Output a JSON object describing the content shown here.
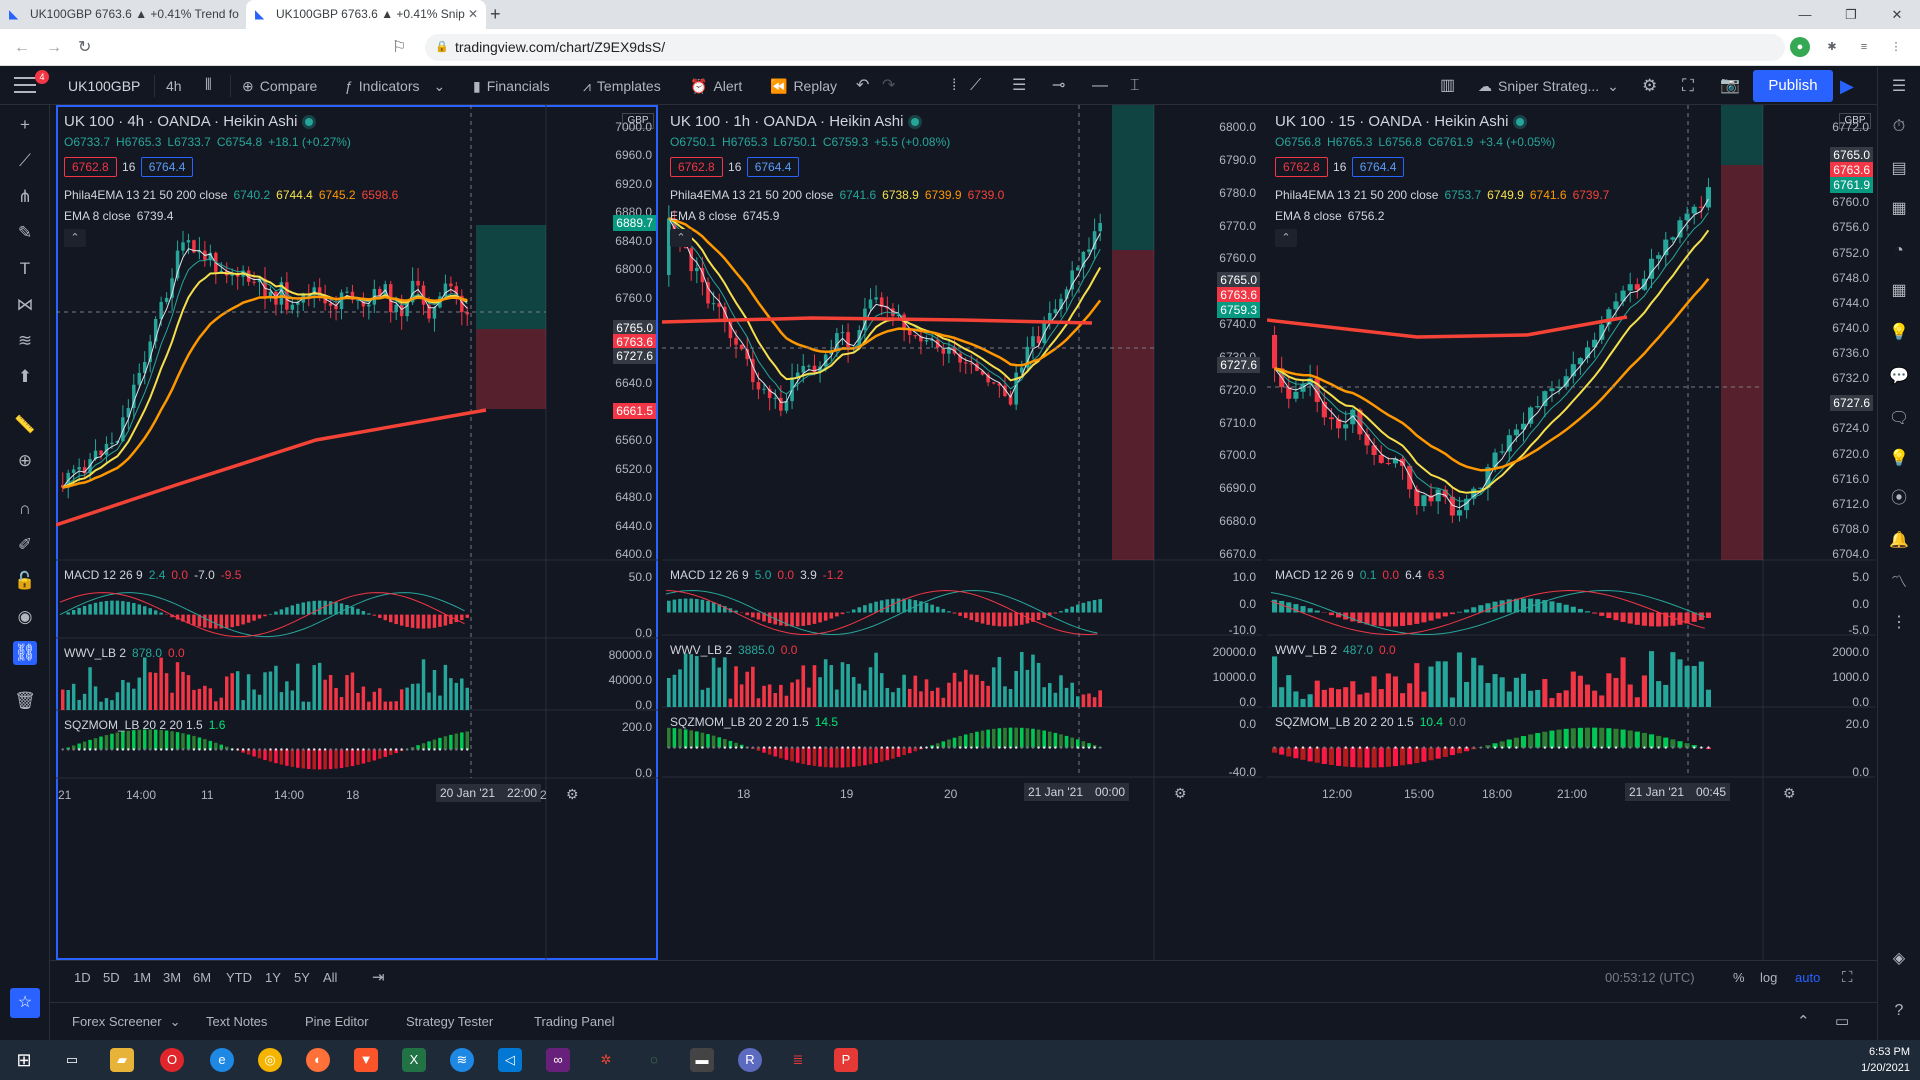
{
  "browser": {
    "tabs": [
      {
        "title": "UK100GBP 6763.6 ▲ +0.41% Trend fo"
      },
      {
        "title": "UK100GBP 6763.6 ▲ +0.41% Snip"
      }
    ],
    "url": "tradingview.com/chart/Z9EX9dsS/"
  },
  "toolbar": {
    "menu_badge": "4",
    "symbol": "UK100GBP",
    "interval": "4h",
    "compare": "Compare",
    "indicators": "Indicators",
    "financials": "Financials",
    "templates": "Templates",
    "alert": "Alert",
    "replay": "Replay",
    "layout_name": "Sniper Strateg...",
    "publish": "Publish"
  },
  "panes": [
    {
      "title": "UK 100 · 4h · OANDA · Heikin Ashi",
      "ohlc": {
        "o": "O6733.7",
        "h": "H6765.3",
        "l": "L6733.7",
        "c": "C6754.8",
        "chg": "+18.1 (+0.27%)"
      },
      "sell": "6762.8",
      "qty": "16",
      "buy": "6764.4",
      "ema_label": "Phila4EMA 13 21 50 200 close",
      "ema_vals": [
        "6740.2",
        "6744.4",
        "6745.2",
        "6598.6"
      ],
      "ema8_label": "EMA 8 close",
      "ema8_val": "6739.4",
      "macd_label": "MACD 12 26 9",
      "macd_vals": [
        "2.4",
        "0.0",
        "-7.0",
        "-9.5"
      ],
      "wwv_label": "WWV_LB 2",
      "wwv_vals": [
        "878.0",
        "0.0"
      ],
      "sqz_label": "SQZMOM_LB 20 2 20 1.5",
      "sqz_vals": [
        "1.6"
      ],
      "currency": "GBP",
      "price_labels": [
        "7000.0",
        "6960.0",
        "6920.0",
        "6880.0",
        "6840.0",
        "6800.0",
        "6760.0",
        "6720.0",
        "6680.0",
        "6640.0",
        "6600.0",
        "6560.0",
        "6520.0",
        "6480.0",
        "6440.0",
        "6400.0"
      ],
      "price_tags": [
        {
          "val": "6889.7",
          "color": "#089981"
        },
        {
          "val": "6765.0",
          "color": "#363a45"
        },
        {
          "val": "6763.6",
          "color": "#f23645"
        },
        {
          "val": "6727.6",
          "color": "#363a45"
        },
        {
          "val": "6661.5",
          "color": "#f23645"
        }
      ],
      "macd_axis": [
        "50.0",
        "0.0"
      ],
      "wwv_axis": [
        "80000.0",
        "40000.0",
        "0.0"
      ],
      "sqz_axis": [
        "200.0",
        "0.0"
      ],
      "time_labels": [
        "21",
        "14:00",
        "11",
        "14:00",
        "18"
      ],
      "time_sel": [
        "20 Jan '21",
        "22:00"
      ],
      "time_extra": "2"
    },
    {
      "title": "UK 100 · 1h · OANDA · Heikin Ashi",
      "ohlc": {
        "o": "O6750.1",
        "h": "H6765.3",
        "l": "L6750.1",
        "c": "C6759.3",
        "chg": "+5.5 (+0.08%)"
      },
      "sell": "6762.8",
      "qty": "16",
      "buy": "6764.4",
      "ema_label": "Phila4EMA 13 21 50 200 close",
      "ema_vals": [
        "6741.6",
        "6738.9",
        "6739.9",
        "6739.0"
      ],
      "ema8_label": "EMA 8 close",
      "ema8_val": "6745.9",
      "macd_label": "MACD 12 26 9",
      "macd_vals": [
        "5.0",
        "0.0",
        "3.9",
        "-1.2"
      ],
      "wwv_label": "WWV_LB 2",
      "wwv_vals": [
        "3885.0",
        "0.0"
      ],
      "sqz_label": "SQZMOM_LB 20 2 20 1.5",
      "sqz_vals": [
        "14.5"
      ],
      "price_labels": [
        "6800.0",
        "6790.0",
        "6780.0",
        "6770.0",
        "6760.0",
        "6750.0",
        "6740.0",
        "6730.0",
        "6720.0",
        "6710.0",
        "6700.0",
        "6690.0",
        "6680.0",
        "6670.0"
      ],
      "price_tags": [
        {
          "val": "6765.0",
          "color": "#363a45"
        },
        {
          "val": "6763.6",
          "color": "#f23645"
        },
        {
          "val": "6759.3",
          "color": "#089981"
        },
        {
          "val": "6727.6",
          "color": "#363a45"
        }
      ],
      "macd_axis": [
        "10.0",
        "0.0",
        "-10.0"
      ],
      "wwv_axis": [
        "20000.0",
        "10000.0",
        "0.0"
      ],
      "sqz_axis": [
        "0.0",
        "-40.0"
      ],
      "time_labels": [
        "18",
        "19",
        "20"
      ],
      "time_sel": [
        "21 Jan '21",
        "00:00"
      ]
    },
    {
      "title": "UK 100 · 15 · OANDA · Heikin Ashi",
      "ohlc": {
        "o": "O6756.8",
        "h": "H6765.3",
        "l": "L6756.8",
        "c": "C6761.9",
        "chg": "+3.4 (+0.05%)"
      },
      "sell": "6762.8",
      "qty": "16",
      "buy": "6764.4",
      "ema_label": "Phila4EMA 13 21 50 200 close",
      "ema_vals": [
        "6753.7",
        "6749.9",
        "6741.6",
        "6739.7"
      ],
      "ema8_label": "EMA 8 close",
      "ema8_val": "6756.2",
      "macd_label": "MACD 12 26 9",
      "macd_vals": [
        "0.1",
        "0.0",
        "6.4",
        "6.3"
      ],
      "wwv_label": "WWV_LB 2",
      "wwv_vals": [
        "487.0",
        "0.0"
      ],
      "sqz_label": "SQZMOM_LB 20 2 20 1.5",
      "sqz_vals": [
        "10.4",
        "0.0"
      ],
      "currency": "GBP",
      "price_labels": [
        "6772.0",
        "6768.0",
        "6764.0",
        "6760.0",
        "6756.0",
        "6752.0",
        "6748.0",
        "6744.0",
        "6740.0",
        "6736.0",
        "6732.0",
        "6728.0",
        "6724.0",
        "6720.0",
        "6716.0",
        "6712.0",
        "6708.0",
        "6704.0"
      ],
      "price_tags": [
        {
          "val": "6765.0",
          "color": "#363a45"
        },
        {
          "val": "6763.6",
          "color": "#f23645"
        },
        {
          "val": "6761.9",
          "color": "#089981"
        },
        {
          "val": "6727.6",
          "color": "#363a45"
        }
      ],
      "macd_axis": [
        "5.0",
        "0.0",
        "-5.0"
      ],
      "wwv_axis": [
        "2000.0",
        "1000.0",
        "0.0"
      ],
      "sqz_axis": [
        "20.0",
        "0.0"
      ],
      "time_labels": [
        "12:00",
        "15:00",
        "18:00",
        "21:00"
      ],
      "time_sel": [
        "21 Jan '21",
        "00:45"
      ]
    }
  ],
  "range_buttons": [
    "1D",
    "5D",
    "1M",
    "3M",
    "6M",
    "YTD",
    "1Y",
    "5Y",
    "All"
  ],
  "clock": "00:53:12 (UTC)",
  "scale_opts": [
    "%",
    "log",
    "auto"
  ],
  "bottom_tabs": [
    "Forex Screener",
    "Text Notes",
    "Pine Editor",
    "Strategy Tester",
    "Trading Panel"
  ],
  "taskbar": {
    "time": "6:53 PM",
    "date": "1/20/2021"
  },
  "colors": {
    "accent": "#2962ff",
    "up": "#26a69a",
    "down": "#f23645",
    "ema_yellow": "#f5e04b",
    "ema_orange": "#ff9800",
    "ema_red": "#f44336"
  }
}
